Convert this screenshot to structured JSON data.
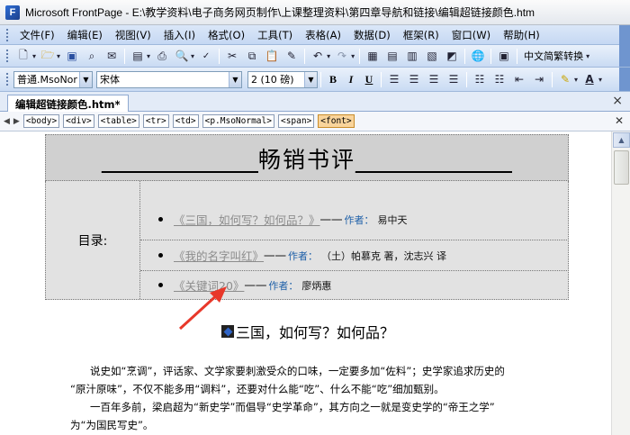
{
  "window": {
    "title": "Microsoft FrontPage - E:\\教学资料\\电子商务网页制作\\上课整理资料\\第四章导航和链接\\编辑超链接颜色.htm",
    "app_icon": "frontpage-icon"
  },
  "menu": [
    "文件(F)",
    "编辑(E)",
    "视图(V)",
    "插入(I)",
    "格式(O)",
    "工具(T)",
    "表格(A)",
    "数据(D)",
    "框架(R)",
    "窗口(W)",
    "帮助(H)"
  ],
  "toolbar": {
    "lang_convert": "中文简繁转换"
  },
  "format_bar": {
    "style": "普通.MsoNor",
    "font": "宋体",
    "size": "2 (10 磅)",
    "bold": "B",
    "italic": "I",
    "underline": "U"
  },
  "doc_tab": {
    "label": "编辑超链接颜色.htm*"
  },
  "tags": [
    "<body>",
    "<div>",
    "<table>",
    "<tr>",
    "<td>",
    "<p.MsoNormal>",
    "<span>",
    "<font>"
  ],
  "page": {
    "header": {
      "left_line": "____________",
      "title": "畅销书评",
      "right_line": "____________"
    },
    "toc_label": "目录:",
    "toc": [
      {
        "link": "《三国，如何写？如何品？》",
        "dash": "一一",
        "author_label": "作者：",
        "author": "易中天"
      },
      {
        "link": "《我的名字叫红》",
        "dash": "一一",
        "author_label": "作者：",
        "author": "（土）帕慕克 著，沈志兴 译"
      },
      {
        "link": "《关键词20》",
        "dash": "一一",
        "author_label": "作者：",
        "author": "廖炳惠"
      }
    ],
    "article_title": "三国，如何写？如何品？",
    "paragraphs": [
      [
        "说史如“烹调”，评话家、文学家要刺激受众的口味，一定要多加“佐料”；史学家追求历史的",
        "“原汁原味”，不仅不能多用“调料”，还要对什么能“吃”、什么不能“吃”细加甄别。"
      ],
      [
        "一百年多前，梁启超为“新史学”而倡导“史学革命”，其方向之一就是变史学的“帝王之学”",
        "为“为国民写史”。"
      ]
    ]
  }
}
